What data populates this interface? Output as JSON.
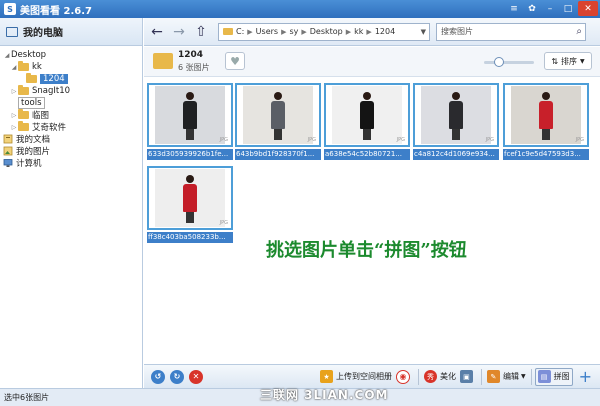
{
  "window": {
    "title": "美图看看 2.6.7",
    "logo_text": "S"
  },
  "sidebar": {
    "header": "我的电脑",
    "tree": [
      {
        "label": "Desktop",
        "level": 0,
        "expanded": true
      },
      {
        "label": "kk",
        "level": 1,
        "expanded": true
      },
      {
        "label": "1204",
        "level": 2,
        "selected": true
      },
      {
        "label": "SnagIt10",
        "level": 1
      },
      {
        "label": "tools",
        "level": 1,
        "boxed": true
      },
      {
        "label": "临图",
        "level": 1
      },
      {
        "label": "艾奇软件",
        "level": 1
      },
      {
        "label": "我的文档",
        "level": 0,
        "icon": "documents-icon"
      },
      {
        "label": "我的图片",
        "level": 0,
        "icon": "pictures-icon"
      },
      {
        "label": "计算机",
        "level": 0,
        "icon": "computer-icon"
      }
    ]
  },
  "toolbar": {
    "path": [
      "C:",
      "Users",
      "sy",
      "Desktop",
      "kk",
      "1204"
    ],
    "search_placeholder": "搜索图片"
  },
  "info": {
    "folder_name": "1204",
    "count_text": "6 张图片",
    "sort_label": "排序",
    "zoom_level": 0.3
  },
  "images": [
    {
      "name": "633d305939926b1fe...",
      "coat": "#1f2022",
      "bg": "#d8dade"
    },
    {
      "name": "643b9bd1f928370f1...",
      "coat": "#5a5e66",
      "bg": "#e6e4e0"
    },
    {
      "name": "a638e54c52b80721...",
      "coat": "#141414",
      "bg": "#f0f0f0"
    },
    {
      "name": "c4a812c4d1069e934...",
      "coat": "#2a2a2e",
      "bg": "#dcdde2"
    },
    {
      "name": "fcef1c9e5d47593d3...",
      "coat": "#c8202a",
      "bg": "#d9d6d0"
    },
    {
      "name": "ff38c403ba508233b...",
      "coat": "#c41d28",
      "bg": "#eeeeee"
    }
  ],
  "hint_text": "挑选图片单击“拼图”按钮",
  "bottom": {
    "upload": "上传到空间相册",
    "beautify": "美化",
    "edit": "编辑",
    "puzzle": "拼图",
    "add": "+"
  },
  "status_text": "选中6张图片",
  "watermark": "三联网 3LIAN.COM"
}
